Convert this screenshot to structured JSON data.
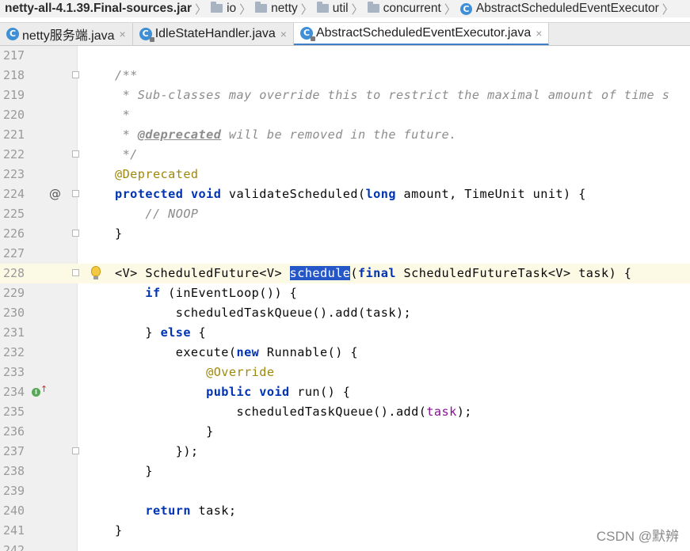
{
  "breadcrumb": {
    "jar": "netty-all-4.1.39.Final-sources.jar",
    "folders": [
      "io",
      "netty",
      "util",
      "concurrent"
    ],
    "class_name": "AbstractScheduledEventExecutor",
    "separator": "〉"
  },
  "tabs": [
    {
      "label": "netty服务端.java",
      "close": "×",
      "active": false
    },
    {
      "label": "IdleStateHandler.java",
      "close": "×",
      "active": false
    },
    {
      "label": "AbstractScheduledEventExecutor.java",
      "close": "×",
      "active": true
    }
  ],
  "editor": {
    "current_line": 228,
    "lines": [
      {
        "num": "217",
        "tokens": []
      },
      {
        "num": "218",
        "tokens": [
          {
            "t": "/**",
            "c": "doc"
          }
        ]
      },
      {
        "num": "219",
        "tokens": [
          {
            "t": " * Sub-classes may override this to restrict the maximal amount of time s",
            "c": "doc"
          }
        ]
      },
      {
        "num": "220",
        "tokens": [
          {
            "t": " *",
            "c": "doc"
          }
        ]
      },
      {
        "num": "221",
        "tokens": [
          {
            "t": " * ",
            "c": "doc"
          },
          {
            "t": "@deprecated",
            "c": "tag"
          },
          {
            "t": " will be removed in the future.",
            "c": "doc"
          }
        ]
      },
      {
        "num": "222",
        "tokens": [
          {
            "t": " */",
            "c": "doc"
          }
        ]
      },
      {
        "num": "223",
        "tokens": [
          {
            "t": "@Deprecated",
            "c": "ann"
          }
        ]
      },
      {
        "num": "224",
        "tokens": [
          {
            "t": "protected",
            "c": "kw"
          },
          {
            "t": " "
          },
          {
            "t": "void",
            "c": "kw"
          },
          {
            "t": " validateScheduled("
          },
          {
            "t": "long",
            "c": "kw"
          },
          {
            "t": " amount, TimeUnit unit) {"
          }
        ]
      },
      {
        "num": "225",
        "tokens": [
          {
            "t": "    "
          },
          {
            "t": "// NOOP",
            "c": "cmt"
          }
        ]
      },
      {
        "num": "226",
        "tokens": [
          {
            "t": "}"
          }
        ]
      },
      {
        "num": "227",
        "tokens": []
      },
      {
        "num": "228",
        "tokens": [
          {
            "t": "<V> ScheduledFuture<V> "
          },
          {
            "t": "schedule",
            "c": "sel"
          },
          {
            "t": "("
          },
          {
            "t": "final",
            "c": "kw"
          },
          {
            "t": " ScheduledFutureTask<V> task) {"
          }
        ]
      },
      {
        "num": "229",
        "tokens": [
          {
            "t": "    "
          },
          {
            "t": "if",
            "c": "kw"
          },
          {
            "t": " (inEventLoop()) {"
          }
        ]
      },
      {
        "num": "230",
        "tokens": [
          {
            "t": "        scheduledTaskQueue().add(task);"
          }
        ]
      },
      {
        "num": "231",
        "tokens": [
          {
            "t": "    } "
          },
          {
            "t": "else",
            "c": "kw"
          },
          {
            "t": " {"
          }
        ]
      },
      {
        "num": "232",
        "tokens": [
          {
            "t": "        execute("
          },
          {
            "t": "new",
            "c": "kw"
          },
          {
            "t": " Runnable() {"
          }
        ]
      },
      {
        "num": "233",
        "tokens": [
          {
            "t": "            "
          },
          {
            "t": "@Override",
            "c": "ann"
          }
        ]
      },
      {
        "num": "234",
        "tokens": [
          {
            "t": "            "
          },
          {
            "t": "public",
            "c": "kw"
          },
          {
            "t": " "
          },
          {
            "t": "void",
            "c": "kw"
          },
          {
            "t": " run() {"
          }
        ]
      },
      {
        "num": "235",
        "tokens": [
          {
            "t": "                scheduledTaskQueue().add("
          },
          {
            "t": "task",
            "c": "par"
          },
          {
            "t": ");"
          }
        ]
      },
      {
        "num": "236",
        "tokens": [
          {
            "t": "            }"
          }
        ]
      },
      {
        "num": "237",
        "tokens": [
          {
            "t": "        });"
          }
        ]
      },
      {
        "num": "238",
        "tokens": [
          {
            "t": "    }"
          }
        ]
      },
      {
        "num": "239",
        "tokens": []
      },
      {
        "num": "240",
        "tokens": [
          {
            "t": "    "
          },
          {
            "t": "return",
            "c": "kw"
          },
          {
            "t": " task;"
          }
        ]
      },
      {
        "num": "241",
        "tokens": [
          {
            "t": "}"
          }
        ]
      },
      {
        "num": "242",
        "tokens": []
      }
    ],
    "fold_marker_lines": [
      "218",
      "222",
      "224",
      "226",
      "228",
      "237"
    ],
    "override_marker_line": "224",
    "override_marker_symbol": "@",
    "intention_bulb_line": "228",
    "implements_marker_line": "234"
  },
  "watermark": "CSDN @默辨",
  "colors": {
    "keyword": "#0033b3",
    "annotation": "#9e880d",
    "comment": "#8c8c8c",
    "parameter": "#871094",
    "selection": "#2657c9",
    "current_line": "#fcfae5"
  }
}
